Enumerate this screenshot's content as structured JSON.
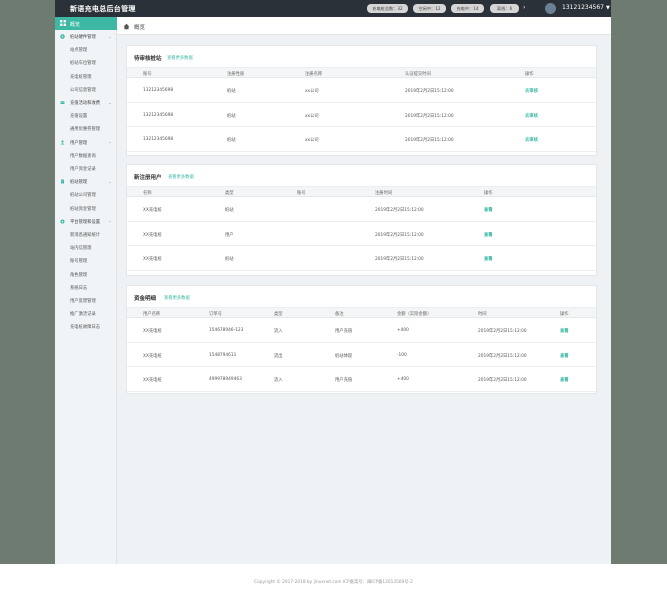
{
  "header": {
    "brand": "新语充电总后台管理",
    "stats": [
      "充电桩总数：32",
      "空闲中：12",
      "充电中：14",
      "离线：6"
    ],
    "account": "13121234567"
  },
  "sidebar": {
    "top": "概览",
    "items": [
      {
        "type": "group",
        "label": "桩站硬件管理",
        "icon": "charger-icon"
      },
      {
        "type": "sub",
        "label": "站点管理"
      },
      {
        "type": "sub",
        "label": "桩站车位管理"
      },
      {
        "type": "sub",
        "label": "充电桩管理"
      },
      {
        "type": "sub",
        "label": "公司信息管理"
      },
      {
        "type": "group",
        "label": "充值活动和收费",
        "icon": "recharge-icon"
      },
      {
        "type": "sub",
        "label": "充值设置"
      },
      {
        "type": "sub",
        "label": "通用优惠券管理"
      },
      {
        "type": "group",
        "label": "用户管理",
        "icon": "user-icon"
      },
      {
        "type": "sub",
        "label": "用户数据查询"
      },
      {
        "type": "sub",
        "label": "用户资金记录"
      },
      {
        "type": "group",
        "label": "桩站管理",
        "icon": "building-icon"
      },
      {
        "type": "sub",
        "label": "桩站公司管理"
      },
      {
        "type": "sub",
        "label": "桩站资金管理"
      },
      {
        "type": "group",
        "label": "平台管理和设置",
        "icon": "settings-icon"
      },
      {
        "type": "sub",
        "label": "新消息通知统计"
      },
      {
        "type": "sub",
        "label": "站内信管理"
      },
      {
        "type": "sub",
        "label": "账号管理"
      },
      {
        "type": "sub",
        "label": "角色管理"
      },
      {
        "type": "sub",
        "label": "系统日志"
      },
      {
        "type": "sub",
        "label": "用户反馈管理"
      },
      {
        "type": "sub",
        "label": "推广激活记录"
      },
      {
        "type": "sub",
        "label": "充电桩故障日志"
      }
    ]
  },
  "page": {
    "title": "概览"
  },
  "panels": {
    "pending": {
      "title": "待审核桩站",
      "link": "查看更多数据",
      "headers": [
        "账号",
        "注册性质",
        "注册名称",
        "认证提交时间",
        "操作"
      ],
      "rows": [
        [
          "13212345698",
          "桩站",
          "xx公司",
          "2019年2月2日15:12:00",
          "去审核"
        ],
        [
          "13212345698",
          "桩站",
          "xx公司",
          "2019年2月2日15:12:00",
          "去审核"
        ],
        [
          "13212345698",
          "桩站",
          "xx公司",
          "2019年2月2日15:12:00",
          "去审核"
        ]
      ]
    },
    "newusers": {
      "title": "新注册用户",
      "link": "查看更多数据",
      "headers": [
        "名称",
        "类型",
        "账号",
        "注册时间",
        "操作"
      ],
      "rows": [
        [
          "XX充电桩",
          "桩站",
          "",
          "2019年2月2日15:12:00",
          "查看"
        ],
        [
          "XX充电桩",
          "用户",
          "",
          "2019年2月2日15:12:00",
          "查看"
        ],
        [
          "XX充电桩",
          "桩站",
          "",
          "2019年2月2日15:12:00",
          "查看"
        ]
      ]
    },
    "funds": {
      "title": "资金明细",
      "link": "查看更多数据",
      "headers": [
        "用户名称",
        "订单号",
        "类型",
        "备注",
        "金额（实际金额）",
        "时间",
        "操作"
      ],
      "rows": [
        [
          "XX充电桩",
          "154678946-123",
          "流入",
          "用户充值",
          "+400",
          "2019年2月2日15:12:00",
          "查看"
        ],
        [
          "XX充电桩",
          "1548794611",
          "流出",
          "桩站体现",
          "-100",
          "2019年2月2日15:12:00",
          "查看"
        ],
        [
          "XX充电桩",
          "499978949463",
          "流入",
          "用户充值",
          "+400",
          "2019年2月2日15:12:00",
          "查看"
        ]
      ]
    }
  },
  "footer": {
    "text": "Copyright © 2017-2018 by jinuxnet.com ICP备案号：闽ICP备12013509号-2"
  },
  "colors": {
    "accent": "#3cb8a4",
    "topbar": "#2b3138",
    "sidebar_bg": "#f0f4f7",
    "outer_bg": "#6e7b71"
  }
}
